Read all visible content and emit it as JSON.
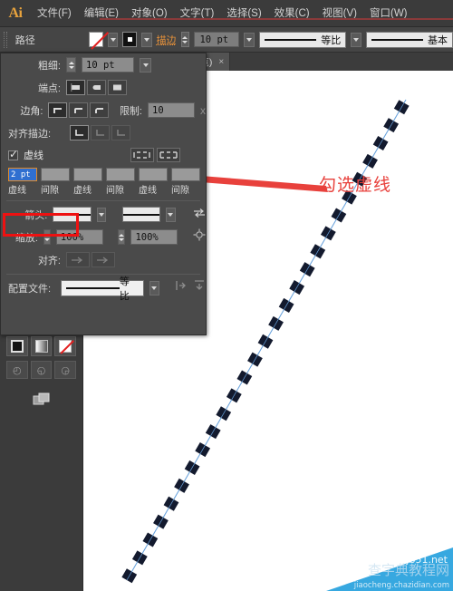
{
  "app": {
    "logo": "Ai",
    "accent_orange": "#e8923a",
    "panel_bg": "#4a4a4a",
    "chrome_bg": "#3b3b3b",
    "annotation_red": "#e8413c"
  },
  "menubar": {
    "items": [
      {
        "label": "文件(F)"
      },
      {
        "label": "编辑(E)"
      },
      {
        "label": "对象(O)"
      },
      {
        "label": "文字(T)"
      },
      {
        "label": "选择(S)"
      },
      {
        "label": "效果(C)"
      },
      {
        "label": "视图(V)"
      },
      {
        "label": "窗口(W)"
      }
    ]
  },
  "controlbar": {
    "selection_label": "路径",
    "stroke_label": "描边",
    "stroke_weight": "10 pt",
    "profile1": "等比",
    "profile2": "基本"
  },
  "doc_tab": {
    "name": "K/预览)",
    "close": "×"
  },
  "stroke_panel": {
    "weight_label": "粗细:",
    "weight_value": "10 pt",
    "cap_label": "端点:",
    "corner_label": "边角:",
    "limit_label": "限制:",
    "limit_value": "10",
    "limit_unit": "x",
    "align_stroke_label": "对齐描边:",
    "dashed_label": "虚线",
    "dashed_checked": true,
    "dash_fields": [
      {
        "value": "2 pt",
        "caption": "虚线",
        "selected": true
      },
      {
        "value": "",
        "caption": "间隙",
        "selected": false
      },
      {
        "value": "",
        "caption": "虚线",
        "selected": false
      },
      {
        "value": "",
        "caption": "间隙",
        "selected": false
      },
      {
        "value": "",
        "caption": "虚线",
        "selected": false
      },
      {
        "value": "",
        "caption": "间隙",
        "selected": false
      }
    ],
    "arrowhead_label": "箭头:",
    "scale_label": "缩放:",
    "scale1": "100%",
    "scale2": "100%",
    "align_label": "对齐:",
    "profile_label": "配置文件:",
    "profile_value": "等比"
  },
  "annotation": {
    "text": "勾选虚线"
  },
  "toolbar": {
    "tools": [
      {
        "name": "symbol-sprayer-tool"
      },
      {
        "name": "column-graph-tool"
      },
      {
        "name": "artboard-tool"
      },
      {
        "name": "eyedropper-tool"
      },
      {
        "name": "hand-tool"
      },
      {
        "name": "zoom-tool"
      }
    ],
    "fill_label": "无填色",
    "stroke_label": "黑色描边",
    "color_modes": [
      "color",
      "gradient",
      "none"
    ],
    "draw_modes": [
      "draw-normal",
      "draw-behind",
      "draw-inside"
    ],
    "screen_mode": "更改屏幕模式"
  },
  "watermark": {
    "line1": "jb51.net",
    "line2": "查字典教程网",
    "line3": "jiaocheng.chazidian.com"
  },
  "artwork": {
    "description": "dashed diagonal path",
    "dash_color": "#131a2e",
    "path_color": "#6aa3dd"
  }
}
